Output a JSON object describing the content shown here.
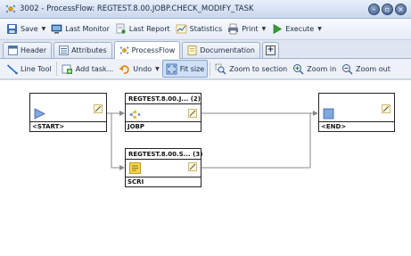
{
  "window": {
    "title": "3002 - ProcessFlow: REGTEST.8.00.JOBP.CHECK_MODIFY_TASK"
  },
  "toolbar": {
    "save": "Save",
    "last_monitor": "Last Monitor",
    "last_report": "Last Report",
    "statistics": "Statistics",
    "print": "Print",
    "execute": "Execute"
  },
  "tabs": [
    {
      "label": "Header",
      "active": false
    },
    {
      "label": "Attributes",
      "active": false
    },
    {
      "label": "ProcessFlow",
      "active": true
    },
    {
      "label": "Documentation",
      "active": false
    },
    {
      "label": "+",
      "active": false
    }
  ],
  "toolbar2": {
    "line_tool": "Line Tool",
    "add_task": "Add task...",
    "undo": "Undo",
    "fit_size": "Fit size",
    "zoom_to_section": "Zoom to section",
    "zoom_in": "Zoom in",
    "zoom_out": "Zoom out"
  },
  "flow": {
    "nodes": {
      "start": {
        "title": "",
        "label": "<START>"
      },
      "jobp": {
        "title": "REGTEST.8.00.J... (2)",
        "label": "JOBP"
      },
      "scri": {
        "title": "REGTEST.8.00.S... (3)",
        "label": "SCRI"
      },
      "end": {
        "title": "",
        "label": "<END>"
      }
    }
  },
  "colors": {
    "accent": "#3a6fc4",
    "titlebar": "#c9d7ec",
    "tab_active": "#ffffff"
  }
}
